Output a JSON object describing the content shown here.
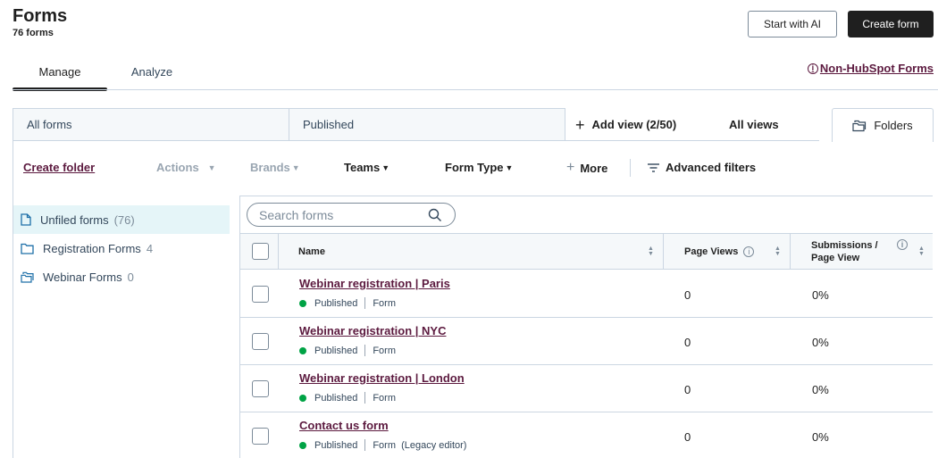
{
  "header": {
    "title": "Forms",
    "subtitle": "76 forms",
    "start_ai_label": "Start with AI",
    "create_label": "Create form"
  },
  "tabs": [
    {
      "label": "Manage",
      "active": true
    },
    {
      "label": "Analyze",
      "active": false
    }
  ],
  "non_hubspot_link": "Non-HubSpot Forms",
  "views": {
    "tabs": [
      "All forms",
      "Published"
    ],
    "add_view": "Add view (2/50)",
    "all_views": "All views",
    "folders": "Folders"
  },
  "filters": {
    "create_folder": "Create folder",
    "actions": "Actions",
    "brands": "Brands",
    "teams": "Teams",
    "form_type": "Form Type",
    "more": "More",
    "advanced": "Advanced filters"
  },
  "folders": [
    {
      "name": "Unfiled forms",
      "count": "(76)",
      "active": true
    },
    {
      "name": "Registration Forms",
      "count": "4",
      "active": false
    },
    {
      "name": "Webinar Forms",
      "count": "0",
      "active": false
    }
  ],
  "search": {
    "placeholder": "Search forms"
  },
  "table": {
    "columns": {
      "name": "Name",
      "page_views": "Page Views",
      "submissions_line1": "Submissions /",
      "submissions_line2": "Page View"
    },
    "rows": [
      {
        "name": "Webinar registration | Paris",
        "status": "Published",
        "type": "Form",
        "page_views": "0",
        "rate": "0%"
      },
      {
        "name": "Webinar registration | NYC",
        "status": "Published",
        "type": "Form",
        "page_views": "0",
        "rate": "0%"
      },
      {
        "name": "Webinar registration | London",
        "status": "Published",
        "type": "Form",
        "page_views": "0",
        "rate": "0%"
      },
      {
        "name": "Contact us form",
        "status": "Published",
        "type": "Form  (Legacy editor)",
        "page_views": "0",
        "rate": "0%"
      }
    ]
  },
  "colors": {
    "link": "#5c1a3f",
    "published_dot": "#00a345",
    "active_folder_bg": "#e5f5f8",
    "primary_button": "#1f1f1f"
  }
}
